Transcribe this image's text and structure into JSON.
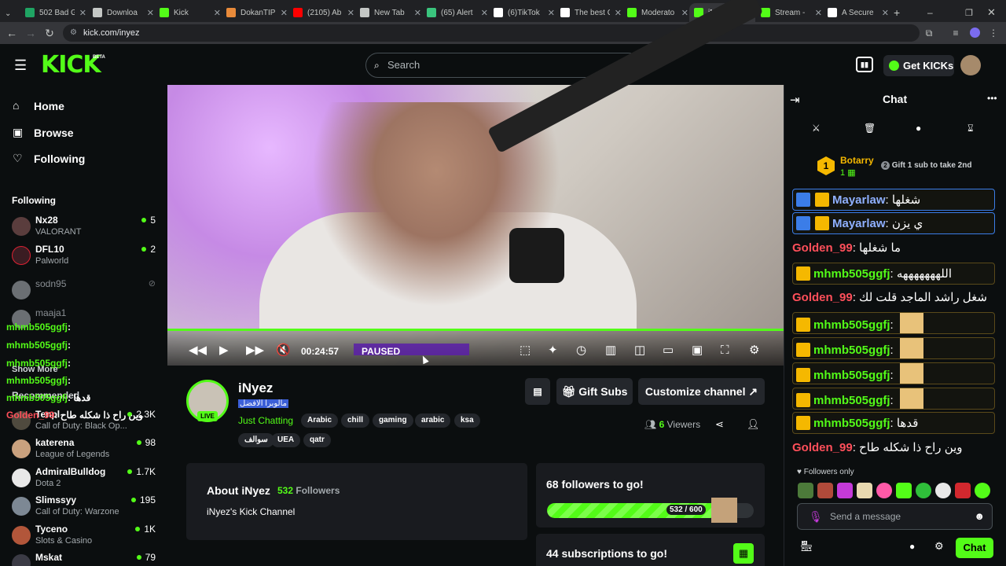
{
  "browser": {
    "tabs": [
      {
        "label": "502 Bad G",
        "icon": "tab-502-icon",
        "color": "#1fa463"
      },
      {
        "label": "Downloa",
        "icon": "download-icon",
        "color": "#c4c7c5"
      },
      {
        "label": "Kick",
        "icon": "kick-icon",
        "color": "#53fc18"
      },
      {
        "label": "DokanTIP",
        "icon": "dokan-icon",
        "color": "#e88a3a"
      },
      {
        "label": "(2105) Ab",
        "icon": "youtube-icon",
        "color": "#ff0000"
      },
      {
        "label": "New Tab",
        "icon": "chrome-icon",
        "color": "#c4c7c5"
      },
      {
        "label": "(65) Alert",
        "icon": "alert-icon",
        "color": "#3ac47d"
      },
      {
        "label": "(6)TikTok",
        "icon": "tiktok-icon",
        "color": "#ffffff"
      },
      {
        "label": "The best C",
        "icon": "diamond-icon",
        "color": "#ffffff"
      },
      {
        "label": "Moderato",
        "icon": "kick-icon",
        "color": "#53fc18"
      },
      {
        "label": "iNyez Stre",
        "icon": "kick-icon",
        "color": "#53fc18",
        "active": true
      },
      {
        "label": "Stream -",
        "icon": "kick-icon",
        "color": "#53fc18"
      },
      {
        "label": "A Secure",
        "icon": "info-icon",
        "color": "#ffffff"
      }
    ],
    "url": "kick.com/inyez"
  },
  "header": {
    "logo": "KICK",
    "beta": "BETA",
    "search_placeholder": "Search",
    "get_kicks": "Get KICKs"
  },
  "sidebar": {
    "nav": [
      {
        "label": "Home",
        "icon": "home-icon"
      },
      {
        "label": "Browse",
        "icon": "browse-icon"
      },
      {
        "label": "Following",
        "icon": "heart-icon"
      }
    ],
    "following_title": "Following",
    "following": [
      {
        "name": "Nx28",
        "game": "VALORANT",
        "viewers": "5"
      },
      {
        "name": "DFL10",
        "game": "Palworld",
        "viewers": "2"
      },
      {
        "name": "sodn95",
        "game": "",
        "viewers": ""
      },
      {
        "name": "maaja1",
        "game": "",
        "viewers": ""
      }
    ],
    "show_more": "Show More",
    "recommended_title": "Recommended",
    "recommended": [
      {
        "name": "Tenpl",
        "game": "Call of Duty: Black Op...",
        "viewers": "2.3K"
      },
      {
        "name": "katerena",
        "game": "League of Legends",
        "viewers": "98"
      },
      {
        "name": "AdmiralBulldog",
        "game": "Dota 2",
        "viewers": "1.7K"
      },
      {
        "name": "Slimssyy",
        "game": "Call of Duty: Warzone",
        "viewers": "195"
      },
      {
        "name": "Tyceno",
        "game": "Slots & Casino",
        "viewers": "1K"
      },
      {
        "name": "Mskat",
        "game": "",
        "viewers": "79"
      }
    ],
    "overlay_msgs": [
      {
        "user": "mhmb505ggfj",
        "text": ":"
      },
      {
        "user": "mhmb505ggfj",
        "text": ":"
      },
      {
        "user": "mhmb505ggfj",
        "text": ":"
      },
      {
        "user": "mhmb505ggfj",
        "text": ":"
      },
      {
        "user": "mhmb505ggfj",
        "text": ": قدها"
      },
      {
        "user": "Golden_99",
        "text": ": وين راح ذا شكله طاح"
      }
    ]
  },
  "player": {
    "time": "00:24:57",
    "state": "PAUSED",
    "progress": 0.94
  },
  "stream": {
    "name": "iNyez",
    "title": "مالوبرا الافضل",
    "live": "LIVE",
    "category": "Just Chatting",
    "tags": [
      "Arabic",
      "chill",
      "gaming",
      "arabic",
      "ksa",
      "سوالف",
      "UEA",
      "qatr"
    ],
    "gift_subs": "Gift Subs",
    "customize": "Customize channel",
    "viewers_count": "6",
    "viewers_label": "Viewers",
    "about_title": "About iNyez",
    "followers_count": "532",
    "followers_label": "Followers",
    "about_text": "iNyez's Kick Channel",
    "goal_text": "68 followers to go!",
    "goal_count": "532 / 600",
    "goal_progress": 0.887,
    "subs_goal": "44 subscriptions to go!"
  },
  "chat": {
    "title": "Chat",
    "top_gifter": "Botarry",
    "top_gifter_rank": "1",
    "top_gifter_count": "1",
    "gift_prompt": "Gift 1 sub to take 2nd",
    "messages": [
      {
        "user": "Mayarlaw",
        "text": "شغلها",
        "style": "blu",
        "box": true,
        "badges": 2
      },
      {
        "user": "Mayarlaw",
        "text": "ي يزن",
        "style": "blu",
        "box": true,
        "badges": 2
      },
      {
        "user": "Golden_99",
        "text": "ما شغلها",
        "style": "red",
        "box": false,
        "badges": 0
      },
      {
        "user": "mhmb505ggfj",
        "text": "اللهههههههه",
        "style": "grn",
        "box": true,
        "badges": 1
      },
      {
        "user": "Golden_99",
        "text": "شغل راشد الماجد قلت لك",
        "style": "red",
        "box": false,
        "badges": 0
      },
      {
        "user": "mhmb505ggfj",
        "text": "",
        "style": "grn",
        "box": true,
        "badges": 1,
        "emote": true
      },
      {
        "user": "mhmb505ggfj",
        "text": "",
        "style": "grn",
        "box": true,
        "badges": 1,
        "emote": true
      },
      {
        "user": "mhmb505ggfj",
        "text": "",
        "style": "grn",
        "box": true,
        "badges": 1,
        "emote": true
      },
      {
        "user": "mhmb505ggfj",
        "text": "",
        "style": "grn",
        "box": true,
        "badges": 1,
        "emote": true
      },
      {
        "user": "mhmb505ggfj",
        "text": "قدها",
        "style": "grn",
        "box": true,
        "badges": 1
      },
      {
        "user": "Golden_99",
        "text": "وين راح ذا شكله طاح",
        "style": "red",
        "box": false,
        "badges": 0
      }
    ],
    "followers_only": "Followers only",
    "placeholder": "Send a message",
    "send_label": "Chat"
  }
}
